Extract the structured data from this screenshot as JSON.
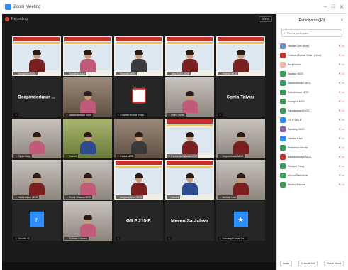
{
  "window": {
    "title": "Zoom Meeting",
    "controls": [
      "–",
      "□",
      "✕"
    ]
  },
  "meeting": {
    "label": "Recording",
    "view_label": "View"
  },
  "tiles": [
    [
      {
        "name": "Bengimlite MOS",
        "kind": "frame",
        "person": "red"
      },
      {
        "name": "Sandeep Kaur",
        "kind": "frame",
        "person": "pink"
      },
      {
        "name": "Raunakt MOS",
        "kind": "frame",
        "person": "dark"
      },
      {
        "name": "Jasp MOS MOS",
        "kind": "frame",
        "person": "red"
      },
      {
        "name": "Hintnee MOS",
        "kind": "frame",
        "person": "red"
      }
    ],
    [
      {
        "name": "Deepinderkaur ...",
        "kind": "name"
      },
      {
        "name": "Jaswinderkaur MOS",
        "kind": "room",
        "person": "pink"
      },
      {
        "name": "Chander Kumar Walk...",
        "kind": "logo"
      },
      {
        "name": "Rhea Gupta",
        "kind": "room2",
        "person": "pink"
      },
      {
        "name": "Sonia Talwar",
        "kind": "name"
      }
    ],
    [
      {
        "name": "Ripan Garg",
        "kind": "room2",
        "person": "pink"
      },
      {
        "name": "Sakshi",
        "kind": "green",
        "person": "blue"
      },
      {
        "name": "Kasha MOS",
        "kind": "room",
        "person": "dark"
      },
      {
        "name": "Purmindervalaulia MOS",
        "kind": "frame",
        "person": "red"
      },
      {
        "name": "Gurpreetkaur MOS",
        "kind": "room2",
        "person": "red"
      }
    ],
    [
      {
        "name": "Harkiratkaur MOS",
        "kind": "room2",
        "person": "red"
      },
      {
        "name": "Ruchi Sharma MOS",
        "kind": "room2",
        "person": "pink"
      },
      {
        "name": "Harpreet Kaur MOS",
        "kind": "frame",
        "person": "red"
      },
      {
        "name": "Harshit",
        "kind": "frame",
        "person": "blue"
      },
      {
        "name": "Mehtab Kaur",
        "kind": "room2",
        "person": "red"
      }
    ],
    [
      {
        "name": "GruditA AT",
        "kind": "avatar",
        "glyph": "r"
      },
      {
        "name": "Rakhee Sharma",
        "kind": "room2",
        "person": "pink"
      },
      {
        "name": "GS P 215-R",
        "kind": "name"
      },
      {
        "name": "Meenu Sachdeva",
        "kind": "name"
      },
      {
        "name": "Sandeep Kumar Ga...",
        "kind": "avatar",
        "glyph": "★"
      }
    ]
  ],
  "panel": {
    "title": "Participants (40)",
    "close": "✕",
    "search_placeholder": "Find a participant",
    "participants": [
      {
        "name": "Neelam Deli (Host)",
        "color": "#6d8fc9"
      },
      {
        "name": "Chander Kumar Walk...(Host)",
        "color": "#c9302c"
      },
      {
        "name": "Sarit Nadar",
        "color": "#e8b9a0"
      },
      {
        "name": "Jaskaur MOS",
        "color": "#3d9b5a"
      },
      {
        "name": "Jaswinderkaur MOS",
        "color": "#3d9b5a"
      },
      {
        "name": "Satinderkaur MOS",
        "color": "#3d9b5a"
      },
      {
        "name": "Kuumpre MOS",
        "color": "#3d9b5a"
      },
      {
        "name": "Kandaunkaur MOS",
        "color": "#3d9b5a"
      },
      {
        "name": "GS P 215-R",
        "color": "#2d8cff"
      },
      {
        "name": "Sandeep MOS",
        "color": "#8a5bb5"
      },
      {
        "name": "Nechtel Kaur",
        "color": "#2d8cff"
      },
      {
        "name": "Phalankar Vinode",
        "color": "#3d9b5a"
      },
      {
        "name": "Aalaskarkumar MOS",
        "color": "#c9302c"
      },
      {
        "name": "Rinalpal Tiring",
        "color": "#3d9b5a"
      },
      {
        "name": "Meenu Sachdeva",
        "color": "#3d9b5a"
      },
      {
        "name": "Sindhu Sharma",
        "color": "#3d9b5a"
      }
    ],
    "footer": [
      "Invite",
      "Unmute Me",
      "Raise Hand"
    ]
  }
}
